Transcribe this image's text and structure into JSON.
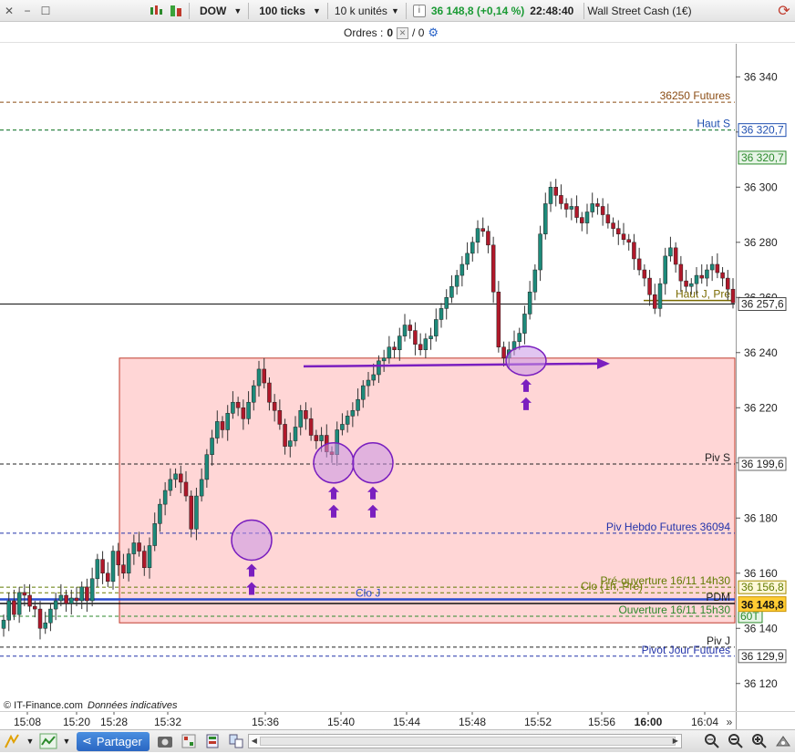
{
  "toolbar": {
    "symbol": "DOW",
    "period": "100 ticks",
    "units": "10 k unités",
    "last_price": "36 148,8 (+0,14 %)",
    "time": "22:48:40",
    "instrument": "Wall Street Cash (1€)"
  },
  "orders": {
    "label": "Ordres :",
    "count_a": "0",
    "count_b": "/ 0"
  },
  "colors": {
    "zone_fill": "#ffd6d6",
    "zone_border": "#c0392b",
    "up": "#1d8a7a",
    "down": "#b0182a",
    "annotation": "#7a1fbf",
    "accent": "#2a66c2"
  },
  "price_axis": {
    "ticks": [
      "36 340",
      "36 320",
      "36 300",
      "36 280",
      "36 260",
      "36 240",
      "36 220",
      "36 200",
      "36 180",
      "36 160",
      "36 140",
      "36 120"
    ],
    "current_price_label": "36 148,8",
    "last_close_label": "36 257,6"
  },
  "levels": [
    {
      "label": "36250 Futures",
      "tag": "",
      "color": "#8a4b12"
    },
    {
      "label": "Haut S",
      "tag": "36 320,7",
      "color": "#1f4fb0"
    },
    {
      "label": "",
      "tag": "36 320,7",
      "color": "#2c8a2c"
    },
    {
      "label": "Haut J, Pré",
      "tag": "",
      "color": "#7a6a00"
    },
    {
      "label": "Piv S",
      "tag": "36 199,6",
      "color": "#222222"
    },
    {
      "label": "Piv Hebdo Futures 36094",
      "tag": "",
      "color": "#2233aa"
    },
    {
      "label": "Pré-ouverture 16/11 14h30",
      "tag": "36 156,8",
      "color": "#5f7a00"
    },
    {
      "label": "Clo (1h, Pré)",
      "tag": "",
      "color": "#6a7a00"
    },
    {
      "label": "Clo J",
      "tag": "",
      "color": "#2a4bd0"
    },
    {
      "label": "PDM",
      "tag": "",
      "color": "#222222"
    },
    {
      "label": "Ouverture 16/11 15h30",
      "tag": "60T",
      "color": "#2c8a2c"
    },
    {
      "label": "Piv J",
      "tag": "",
      "color": "#222222"
    },
    {
      "label": "Pivot Jour Futures",
      "tag": "36 129,9",
      "color": "#2233aa"
    }
  ],
  "time_axis": [
    "15:08",
    "15:20",
    "15:28",
    "15:32",
    "15:36",
    "15:40",
    "15:44",
    "15:48",
    "15:52",
    "15:56",
    "16:00",
    "16:04"
  ],
  "watermark": {
    "source": "© IT-Finance.com",
    "note": "Données indicatives"
  },
  "bottom": {
    "share_label": "Partager"
  },
  "chart_data": {
    "type": "candlestick",
    "title": "",
    "ylim": [
      36110,
      36352
    ],
    "close_path": [
      36143,
      36150,
      36145,
      36153,
      36152,
      36148,
      36147,
      36140,
      36142,
      36147,
      36150,
      36152,
      36149,
      36151,
      36150,
      36155,
      36150,
      36158,
      36165,
      36160,
      36157,
      36168,
      36163,
      36160,
      36167,
      36171,
      36168,
      36162,
      36170,
      36178,
      36185,
      36190,
      36194,
      36196,
      36193,
      36188,
      36176,
      36188,
      36194,
      36203,
      36209,
      36215,
      36212,
      36218,
      36222,
      36220,
      36216,
      36222,
      36228,
      36234,
      36229,
      36222,
      36219,
      36214,
      36206,
      36208,
      36213,
      36219,
      36216,
      36210,
      36208,
      36210,
      36204,
      36203,
      36212,
      36214,
      36217,
      36219,
      36223,
      36228,
      36230,
      36232,
      36237,
      36238,
      36242,
      36241,
      36246,
      36250,
      36248,
      36243,
      36241,
      36245,
      36246,
      36252,
      36256,
      36260,
      36264,
      36268,
      36272,
      36276,
      36280,
      36285,
      36284,
      36279,
      36262,
      36242,
      36238,
      36241,
      36244,
      36247,
      36254,
      36262,
      36270,
      36283,
      36294,
      36300,
      36297,
      36294,
      36292,
      36293,
      36289,
      36287,
      36291,
      36294,
      36293,
      36290,
      36287,
      36285,
      36283,
      36281,
      36280,
      36274,
      36270,
      36267,
      36261,
      36256,
      36265,
      36275,
      36278,
      36272,
      36266,
      36264,
      36265,
      36268,
      36267,
      36270,
      36272,
      36269,
      36267,
      36263,
      36258
    ],
    "shaded_zone": {
      "top": 36238,
      "bottom": 36142
    },
    "trend_arrow": {
      "from": 36235,
      "to": 36236
    },
    "level_prices": [
      36330.8,
      36320.7,
      36320.7,
      36258.9,
      36199.6,
      36174.5,
      36154.9,
      36152.9,
      36150.5,
      36149.0,
      36144.4,
      36133.2,
      36129.9
    ],
    "marker_prices": [
      36172,
      36200,
      36200,
      36237
    ],
    "current_price": 36148.8,
    "last_close": 36257.6
  }
}
